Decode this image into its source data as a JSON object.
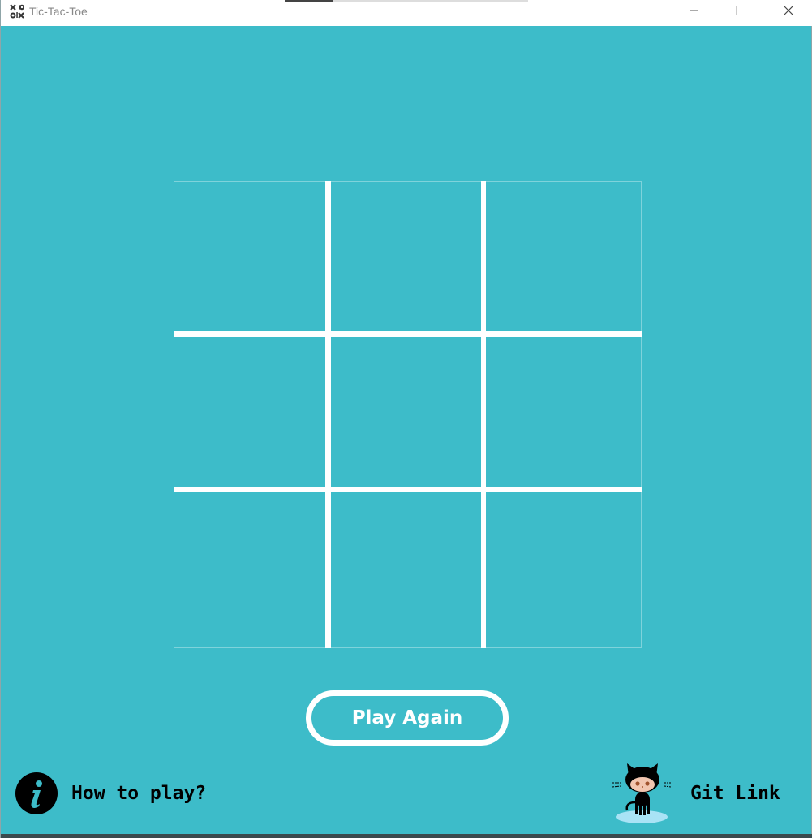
{
  "window": {
    "title": "Tic-Tac-Toe",
    "icon": "tic-tac-toe-app-icon",
    "controls": [
      "minimize",
      "maximize",
      "close"
    ],
    "progress_fraction": 0.2
  },
  "theme": {
    "background": "#3dbcc9",
    "grid_line": "#ffffff",
    "text": "#000000"
  },
  "board": {
    "rows": 3,
    "cols": 3,
    "cells": [
      "",
      "",
      "",
      "",
      "",
      "",
      "",
      "",
      ""
    ]
  },
  "actions": {
    "play_again_label": "Play Again"
  },
  "footer": {
    "how_to_label": "How to play?",
    "how_to_icon": "info-icon",
    "git_label": "Git Link",
    "git_icon": "octocat-icon"
  }
}
